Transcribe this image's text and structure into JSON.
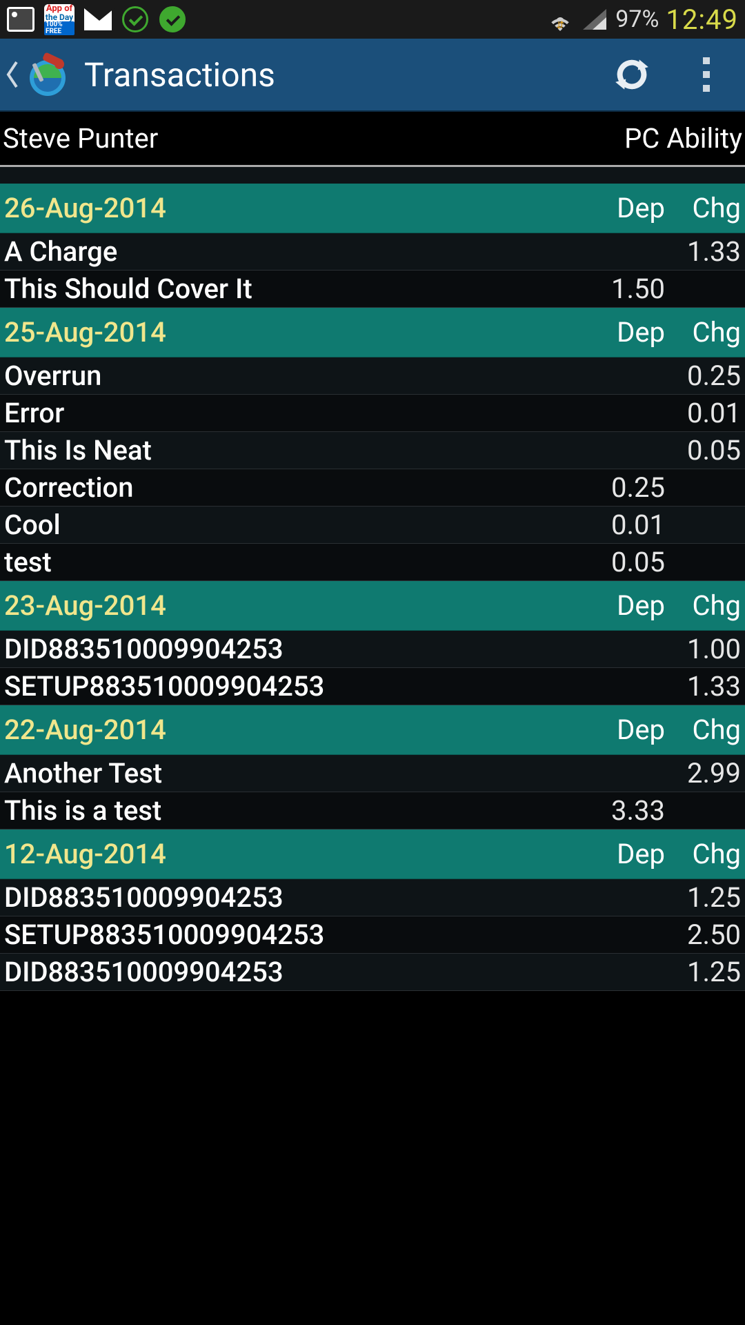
{
  "status": {
    "battery": "97%",
    "clock": "12:49"
  },
  "actionbar": {
    "title": "Transactions"
  },
  "account": {
    "name": "Steve Punter",
    "context": "PC Ability"
  },
  "columns": {
    "dep": "Dep",
    "chg": "Chg"
  },
  "sections": [
    {
      "date": "26-Aug-2014",
      "rows": [
        {
          "desc": "A Charge",
          "dep": "",
          "chg": "1.33"
        },
        {
          "desc": "This Should Cover It",
          "dep": "1.50",
          "chg": ""
        }
      ]
    },
    {
      "date": "25-Aug-2014",
      "rows": [
        {
          "desc": "Overrun",
          "dep": "",
          "chg": "0.25"
        },
        {
          "desc": "Error",
          "dep": "",
          "chg": "0.01"
        },
        {
          "desc": "This Is Neat",
          "dep": "",
          "chg": "0.05"
        },
        {
          "desc": "Correction",
          "dep": "0.25",
          "chg": ""
        },
        {
          "desc": "Cool",
          "dep": "0.01",
          "chg": ""
        },
        {
          "desc": "test",
          "dep": "0.05",
          "chg": ""
        }
      ]
    },
    {
      "date": "23-Aug-2014",
      "rows": [
        {
          "desc": "DID883510009904253",
          "dep": "",
          "chg": "1.00"
        },
        {
          "desc": "SETUP883510009904253",
          "dep": "",
          "chg": "1.33"
        }
      ]
    },
    {
      "date": "22-Aug-2014",
      "rows": [
        {
          "desc": "Another Test",
          "dep": "",
          "chg": "2.99"
        },
        {
          "desc": "This is a test",
          "dep": "3.33",
          "chg": ""
        }
      ]
    },
    {
      "date": "12-Aug-2014",
      "rows": [
        {
          "desc": "DID883510009904253",
          "dep": "",
          "chg": "1.25"
        },
        {
          "desc": "SETUP883510009904253",
          "dep": "",
          "chg": "2.50"
        },
        {
          "desc": "DID883510009904253",
          "dep": "",
          "chg": "1.25"
        }
      ]
    }
  ]
}
